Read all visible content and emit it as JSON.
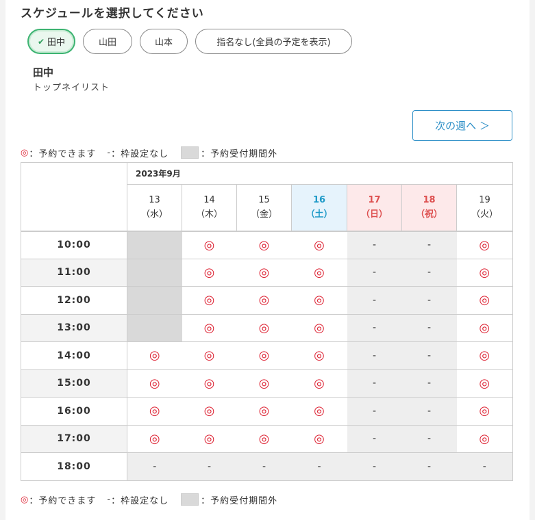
{
  "heading": "スケジュールを選択してください",
  "staff": {
    "options": [
      {
        "label": "田中",
        "selected": true
      },
      {
        "label": "山田",
        "selected": false
      },
      {
        "label": "山本",
        "selected": false
      },
      {
        "label": "指名なし(全員の予定を表示)",
        "selected": false
      }
    ],
    "check_icon": "✔",
    "selected_name": "田中",
    "selected_title": "トップネイリスト"
  },
  "next_week_label": "次の週へ ＞",
  "legend": {
    "available_mark": "◎",
    "available_text": "：予約できます",
    "none_mark": "-",
    "none_text": "：枠設定なし",
    "outside_text": "：予約受付期間外"
  },
  "colors": {
    "accent": "#2d8fc7",
    "selected": "#3cb371",
    "available": "#dd2233",
    "saturday": "#1f9ac8",
    "holiday": "#dd4f4f"
  },
  "calendar": {
    "month": "2023年9月",
    "days": [
      {
        "date": "13",
        "dow": "（水）",
        "kind": "normal"
      },
      {
        "date": "14",
        "dow": "（木）",
        "kind": "normal"
      },
      {
        "date": "15",
        "dow": "（金）",
        "kind": "normal"
      },
      {
        "date": "16",
        "dow": "（土）",
        "kind": "sat"
      },
      {
        "date": "17",
        "dow": "（日）",
        "kind": "hol"
      },
      {
        "date": "18",
        "dow": "（祝）",
        "kind": "hol"
      },
      {
        "date": "19",
        "dow": "（火）",
        "kind": "normal"
      }
    ],
    "slots": [
      {
        "time": "10:00",
        "cells": [
          "x",
          "o",
          "o",
          "o",
          "-",
          "-",
          "o"
        ]
      },
      {
        "time": "11:00",
        "cells": [
          "x",
          "o",
          "o",
          "o",
          "-",
          "-",
          "o"
        ]
      },
      {
        "time": "12:00",
        "cells": [
          "x",
          "o",
          "o",
          "o",
          "-",
          "-",
          "o"
        ]
      },
      {
        "time": "13:00",
        "cells": [
          "x",
          "o",
          "o",
          "o",
          "-",
          "-",
          "o"
        ]
      },
      {
        "time": "14:00",
        "cells": [
          "o",
          "o",
          "o",
          "o",
          "-",
          "-",
          "o"
        ]
      },
      {
        "time": "15:00",
        "cells": [
          "o",
          "o",
          "o",
          "o",
          "-",
          "-",
          "o"
        ]
      },
      {
        "time": "16:00",
        "cells": [
          "o",
          "o",
          "o",
          "o",
          "-",
          "-",
          "o"
        ]
      },
      {
        "time": "17:00",
        "cells": [
          "o",
          "o",
          "o",
          "o",
          "-",
          "-",
          "o"
        ]
      },
      {
        "time": "18:00",
        "cells": [
          "-",
          "-",
          "-",
          "-",
          "-",
          "-",
          "-"
        ]
      }
    ]
  }
}
